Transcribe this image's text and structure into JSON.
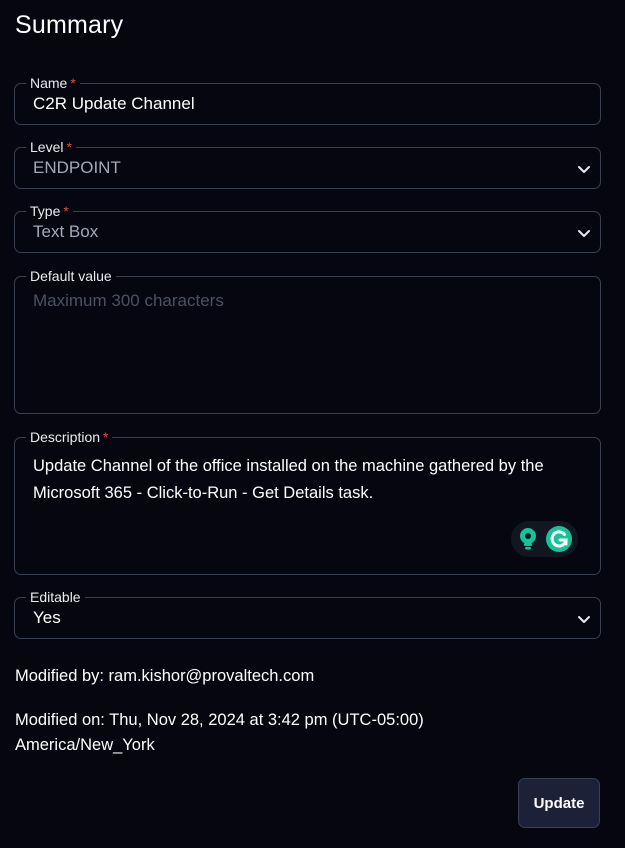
{
  "title": "Summary",
  "fields": {
    "name": {
      "label": "Name",
      "required_mark": "*",
      "value": "C2R Update Channel"
    },
    "level": {
      "label": "Level",
      "required_mark": "*",
      "value": "ENDPOINT"
    },
    "type": {
      "label": "Type",
      "required_mark": "*",
      "value": "Text Box"
    },
    "default_value": {
      "label": "Default value",
      "placeholder": "Maximum 300 characters",
      "value": ""
    },
    "description": {
      "label": "Description",
      "required_mark": "*",
      "value": "Update Channel of the office installed on the machine gathered by the Microsoft 365 - Click-to-Run - Get Details task."
    },
    "editable": {
      "label": "Editable",
      "value": "Yes"
    }
  },
  "meta": {
    "modified_by": "Modified by: ram.kishor@provaltech.com",
    "modified_on_line1": "Modified on: Thu, Nov 28, 2024 at 3:42 pm (UTC-05:00)",
    "modified_on_line2": "America/New_York"
  },
  "actions": {
    "update_label": "Update"
  },
  "icons": {
    "select_arrow": "chevron-down-icon",
    "assistant": "lightbulb-icon",
    "grammarly": "grammarly-icon"
  },
  "colors": {
    "background": "#05060f",
    "border": "#3a3f52",
    "required": "#e0474f",
    "button_bg": "#1d2138",
    "grammarly_green": "#15c39a"
  }
}
